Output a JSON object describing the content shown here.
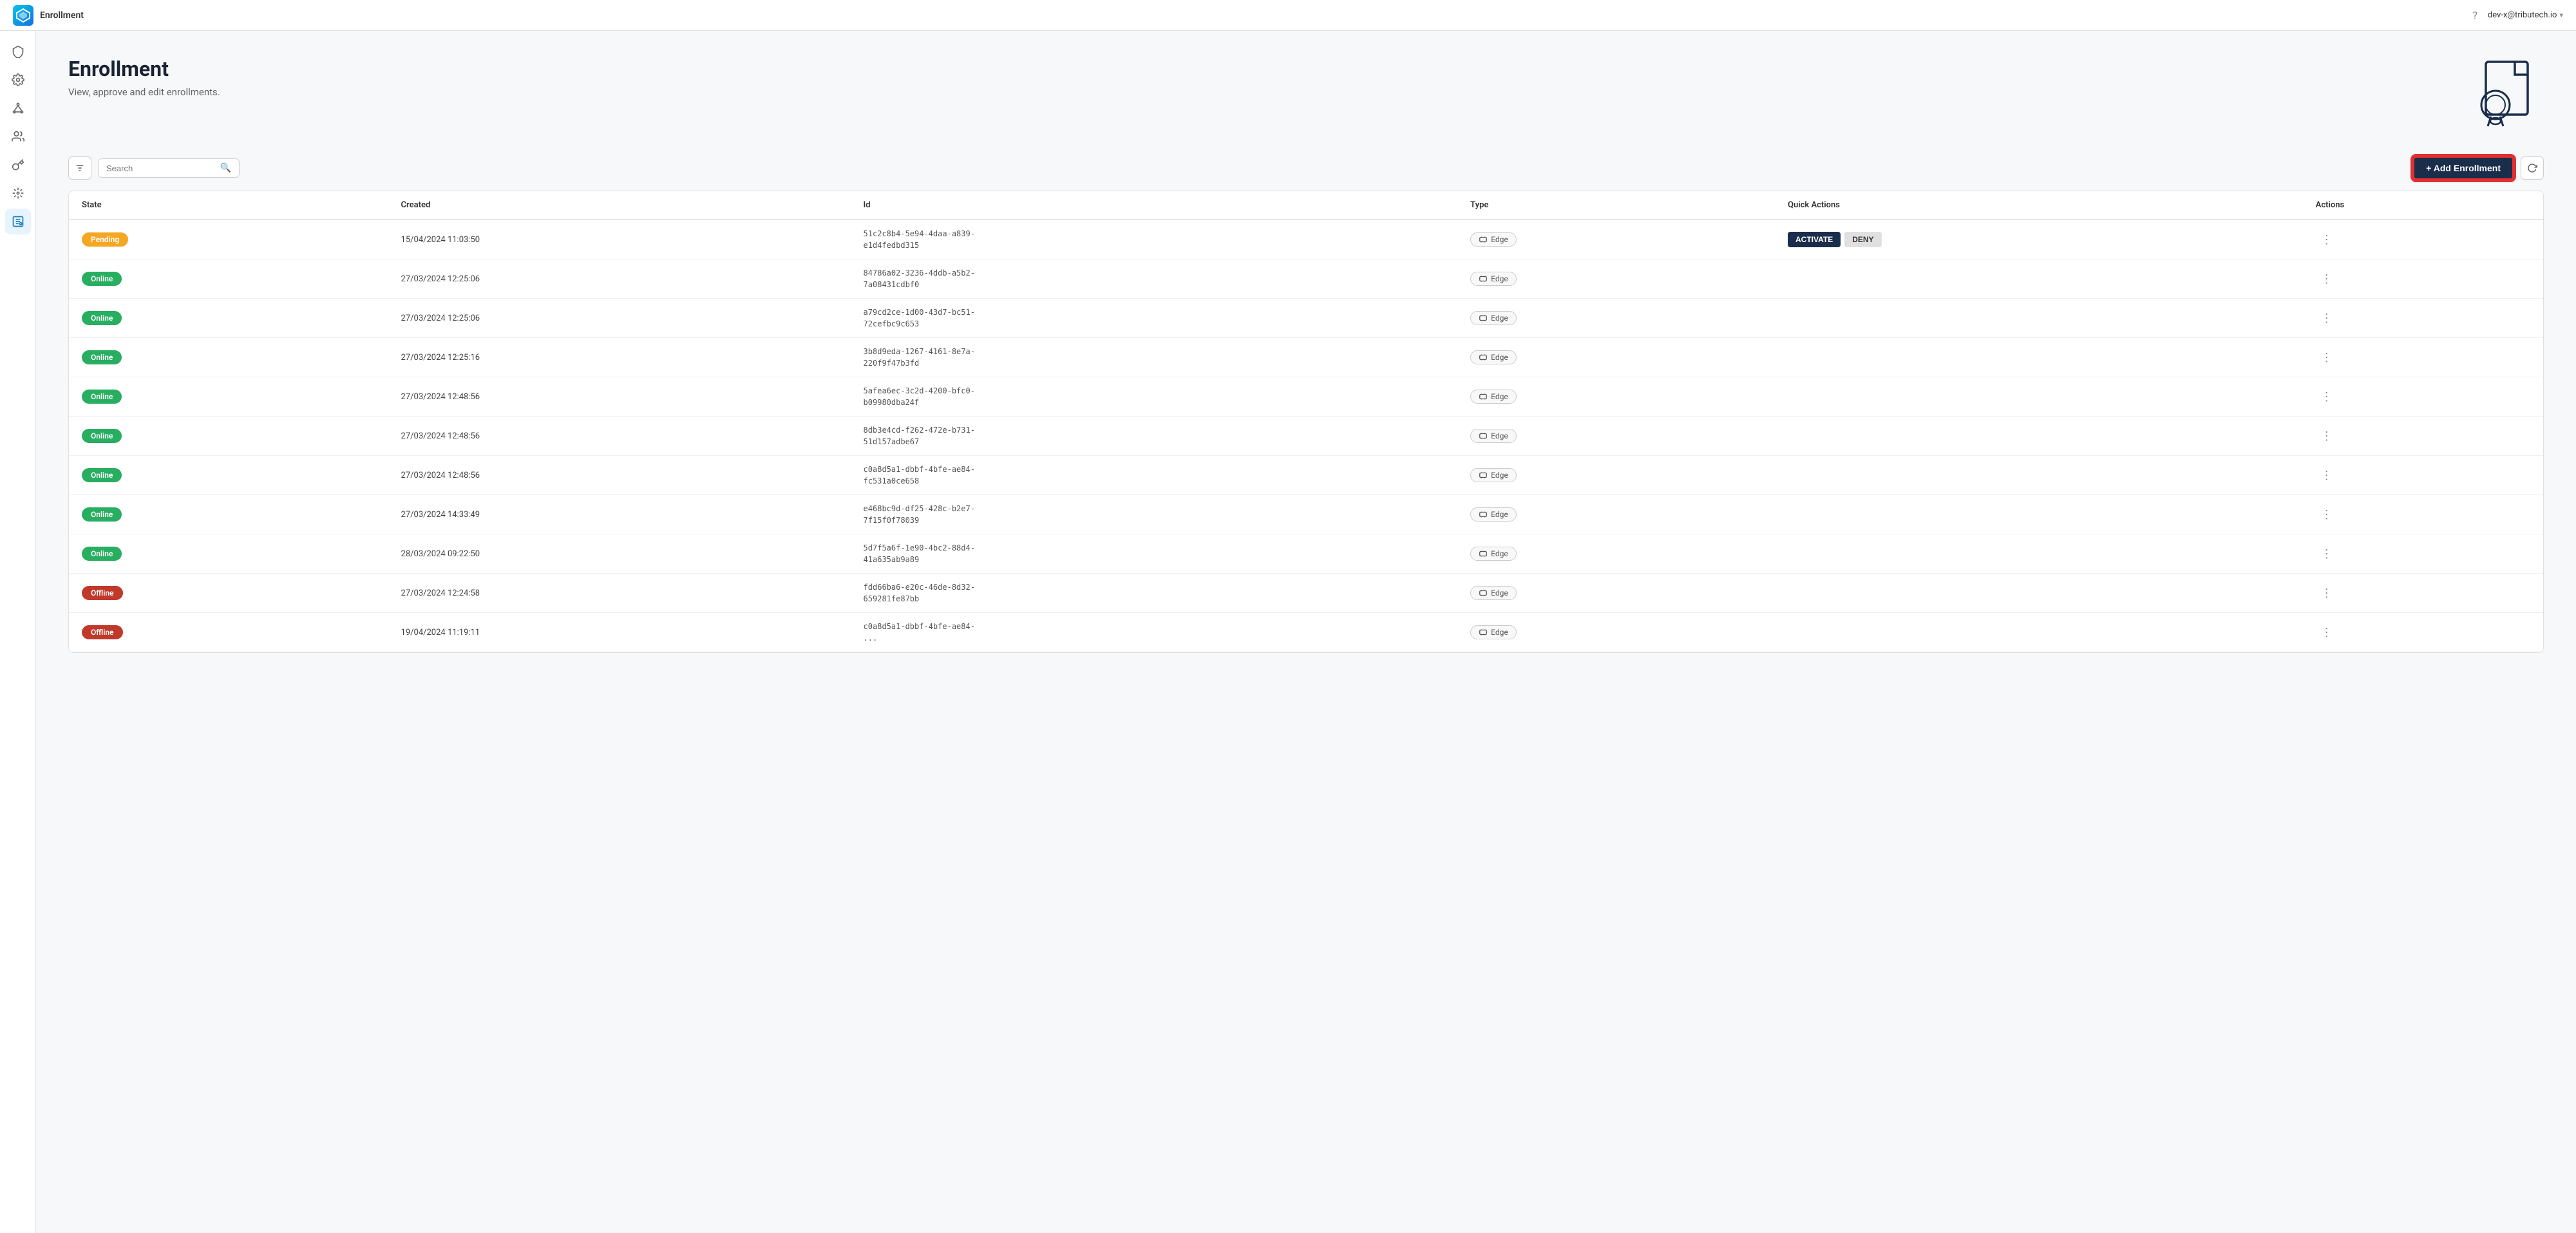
{
  "app": {
    "title": "Enrollment",
    "user": "dev-x@tributech.io"
  },
  "sidebar": {
    "items": [
      {
        "name": "shield-icon",
        "label": "Security",
        "active": false
      },
      {
        "name": "settings-icon",
        "label": "Settings",
        "active": false
      },
      {
        "name": "network-icon",
        "label": "Network",
        "active": false
      },
      {
        "name": "users-icon",
        "label": "Users",
        "active": false
      },
      {
        "name": "key-icon",
        "label": "Keys",
        "active": false
      },
      {
        "name": "integrations-icon",
        "label": "Integrations",
        "active": false
      },
      {
        "name": "enrollment-icon",
        "label": "Enrollment",
        "active": true
      }
    ]
  },
  "page": {
    "title": "Enrollment",
    "subtitle": "View, approve and edit enrollments."
  },
  "toolbar": {
    "search_placeholder": "Search",
    "add_button_label": "+ Add Enrollment",
    "filter_icon": "⊞",
    "refresh_icon": "↻"
  },
  "table": {
    "columns": [
      "State",
      "Created",
      "Id",
      "Type",
      "Quick Actions",
      "Actions"
    ],
    "rows": [
      {
        "state": "Pending",
        "state_class": "badge-pending",
        "created": "15/04/2024 11:03:50",
        "id": "51c2c8b4-5e94-4daa-a839-\ne1d4fedbd315",
        "type": "Edge",
        "has_quick_actions": true
      },
      {
        "state": "Online",
        "state_class": "badge-online",
        "created": "27/03/2024 12:25:06",
        "id": "84786a02-3236-4ddb-a5b2-\n7a08431cdbf0",
        "type": "Edge",
        "has_quick_actions": false
      },
      {
        "state": "Online",
        "state_class": "badge-online",
        "created": "27/03/2024 12:25:06",
        "id": "a79cd2ce-1d00-43d7-bc51-\n72cefbc9c653",
        "type": "Edge",
        "has_quick_actions": false
      },
      {
        "state": "Online",
        "state_class": "badge-online",
        "created": "27/03/2024 12:25:16",
        "id": "3b8d9eda-1267-4161-8e7a-\n220f9f47b3fd",
        "type": "Edge",
        "has_quick_actions": false
      },
      {
        "state": "Online",
        "state_class": "badge-online",
        "created": "27/03/2024 12:48:56",
        "id": "5afea6ec-3c2d-4200-bfc0-\nb09980dba24f",
        "type": "Edge",
        "has_quick_actions": false
      },
      {
        "state": "Online",
        "state_class": "badge-online",
        "created": "27/03/2024 12:48:56",
        "id": "8db3e4cd-f262-472e-b731-\n51d157adbe67",
        "type": "Edge",
        "has_quick_actions": false
      },
      {
        "state": "Online",
        "state_class": "badge-online",
        "created": "27/03/2024 12:48:56",
        "id": "c0a8d5a1-dbbf-4bfe-ae84-\nfc531a0ce658",
        "type": "Edge",
        "has_quick_actions": false
      },
      {
        "state": "Online",
        "state_class": "badge-online",
        "created": "27/03/2024 14:33:49",
        "id": "e468bc9d-df25-428c-b2e7-\n7f15f0f78039",
        "type": "Edge",
        "has_quick_actions": false
      },
      {
        "state": "Online",
        "state_class": "badge-online",
        "created": "28/03/2024 09:22:50",
        "id": "5d7f5a6f-1e90-4bc2-88d4-\n41a635ab9a89",
        "type": "Edge",
        "has_quick_actions": false
      },
      {
        "state": "Offline",
        "state_class": "badge-offline",
        "created": "27/03/2024 12:24:58",
        "id": "fdd66ba6-e20c-46de-8d32-\n659281fe87bb",
        "type": "Edge",
        "has_quick_actions": false
      },
      {
        "state": "Offline",
        "state_class": "badge-offline",
        "created": "19/04/2024 11:19:11",
        "id": "c0a8d5a1-dbbf-4bfe-ae84-\n...",
        "type": "Edge",
        "has_quick_actions": false
      }
    ],
    "activate_label": "ACTIVATE",
    "deny_label": "DENY",
    "edge_label": "Edge"
  }
}
